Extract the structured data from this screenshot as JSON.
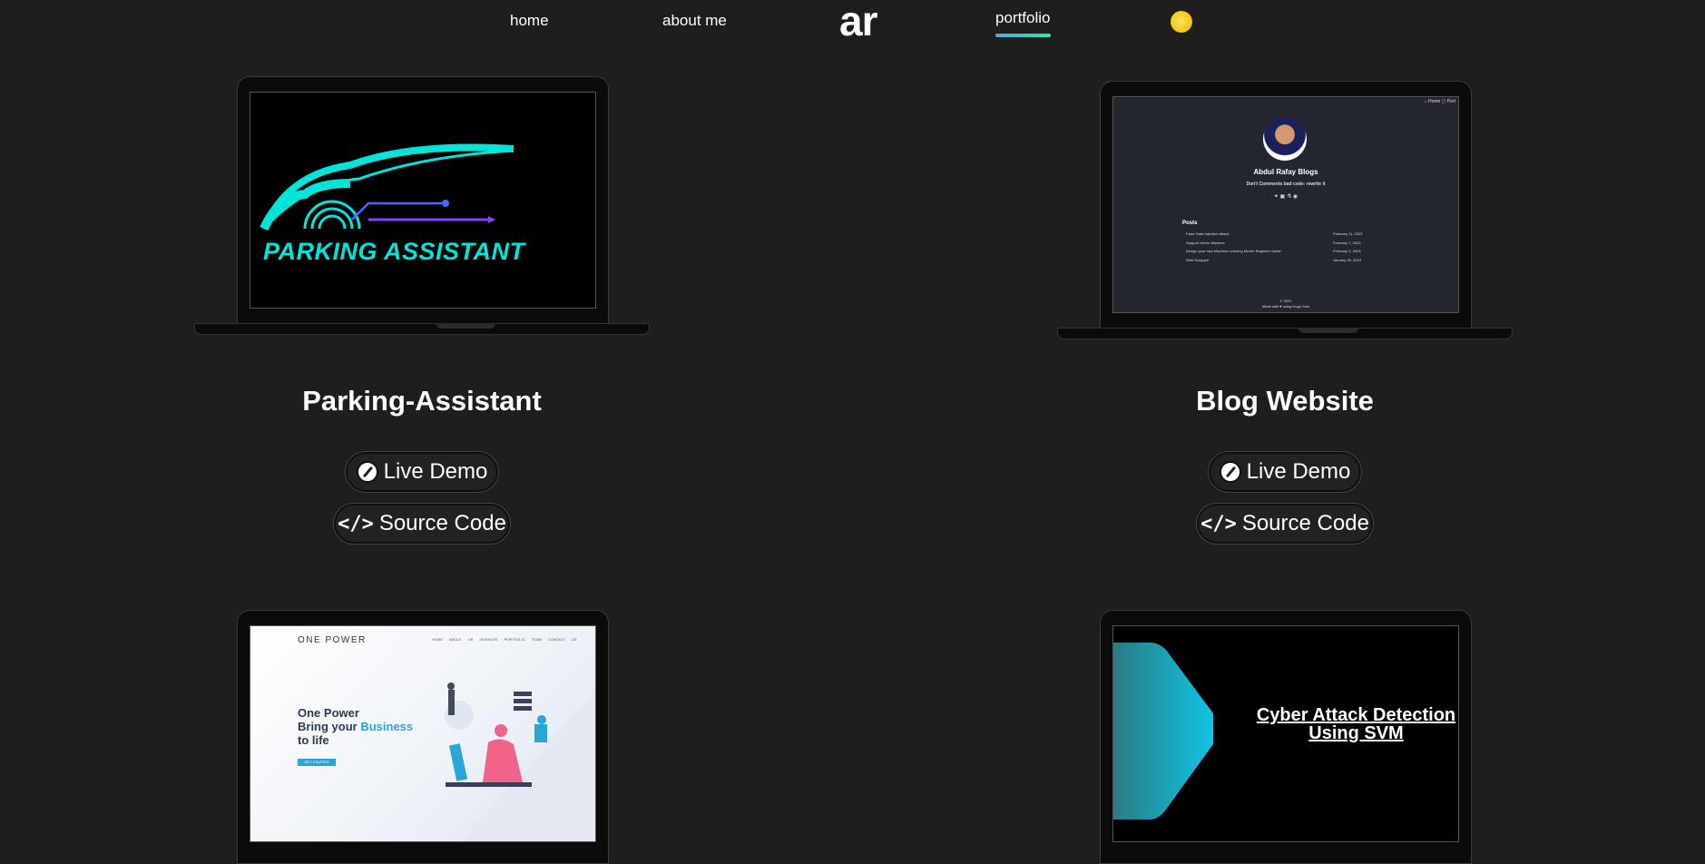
{
  "nav": {
    "home": "home",
    "about": "about me",
    "logo": "ar",
    "portfolio": "portfolio",
    "theme_icon": "sun-icon"
  },
  "projects": [
    {
      "title": "Parking-Assistant",
      "screen_text": "PARKING ASSISTANT",
      "live_demo": "Live Demo",
      "source_code": "Source Code"
    },
    {
      "title": "Blog Website",
      "live_demo": "Live Demo",
      "source_code": "Source Code",
      "screen": {
        "nav": "⌂ Home  ▢ Port",
        "name": "Abdul Rafay Blogs",
        "tagline": "Don't Comments bad code- rewrite it",
        "posts_label": "Posts",
        "posts": [
          {
            "title": "False Data Injection Attack",
            "date": "February 11, 2023"
          },
          {
            "title": "Support Vector Machine",
            "date": "February 7, 2023"
          },
          {
            "title": "Design your own Machine Learning Model: Beginner Guide",
            "date": "February 2, 2023"
          },
          {
            "title": "Web Scrapper",
            "date": "January 26, 2023"
          }
        ],
        "footer": "© 2023",
        "footer2": "Made with ♥ using Hugo Solo"
      }
    },
    {
      "screen": {
        "brand": "ONE POWER",
        "menu": "HOME ABOUT US SERVICES PORTFOLIO TEAM CONTACT US",
        "hero_line1": "One Power",
        "hero_line2a": "Bring your ",
        "hero_line2b": "Business",
        "hero_line3": "to life",
        "cta": "GET STARTED"
      }
    },
    {
      "screen": {
        "title": "Cyber Attack Detection Using SVM"
      }
    }
  ],
  "colors": {
    "background": "#1e1e1e",
    "accent_gradient_start": "#4facd8",
    "accent_gradient_end": "#2ee6a8",
    "parking_cyan": "#00e5d9"
  }
}
